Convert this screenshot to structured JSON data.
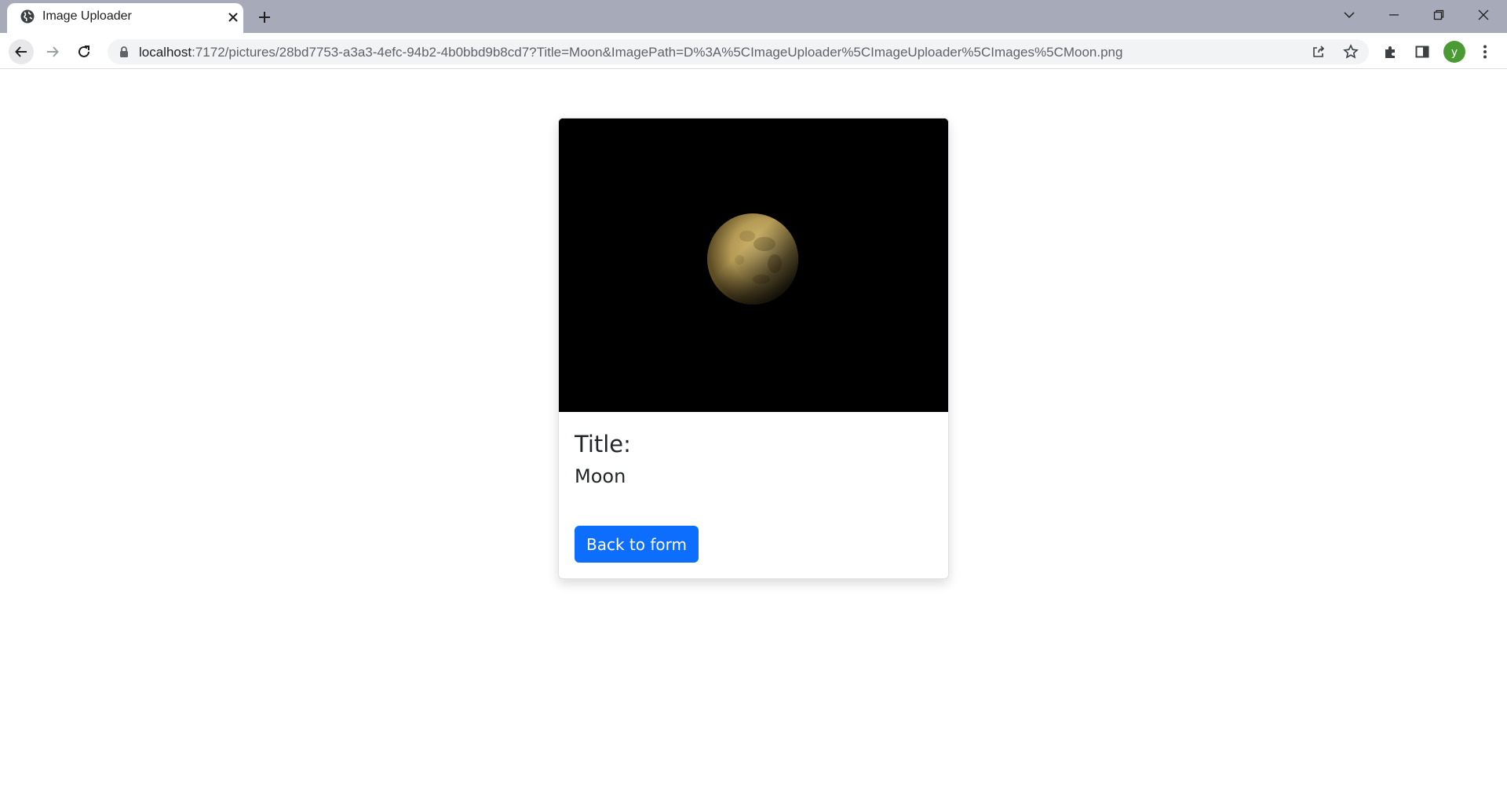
{
  "browser": {
    "tab": {
      "title": "Image Uploader",
      "favicon": "globe-icon",
      "close": "close-icon"
    },
    "new_tab": "plus-icon",
    "window_controls": [
      "chevron-down-icon",
      "minimize-icon",
      "restore-icon",
      "close-icon"
    ],
    "address_bar": {
      "host": "localhost",
      "rest": ":7172/pictures/28bd7753-a3a3-4efc-94b2-4b0bbd9b8cd7?Title=Moon&ImagePath=D%3A%5CImageUploader%5CImageUploader%5CImages%5CMoon.png",
      "lock": "lock-icon"
    },
    "toolbar_icons": [
      "share-icon",
      "star-icon",
      "puzzle-icon",
      "side-panel-icon"
    ],
    "profile_initial": "y"
  },
  "card": {
    "image": "moon-photo",
    "title_label": "Title:",
    "title_value": "Moon",
    "back_button_label": "Back to form"
  },
  "colors": {
    "tabstrip": "#a7abb9",
    "primary_button": "#0d6efd",
    "profile_avatar": "#4a9b34"
  }
}
